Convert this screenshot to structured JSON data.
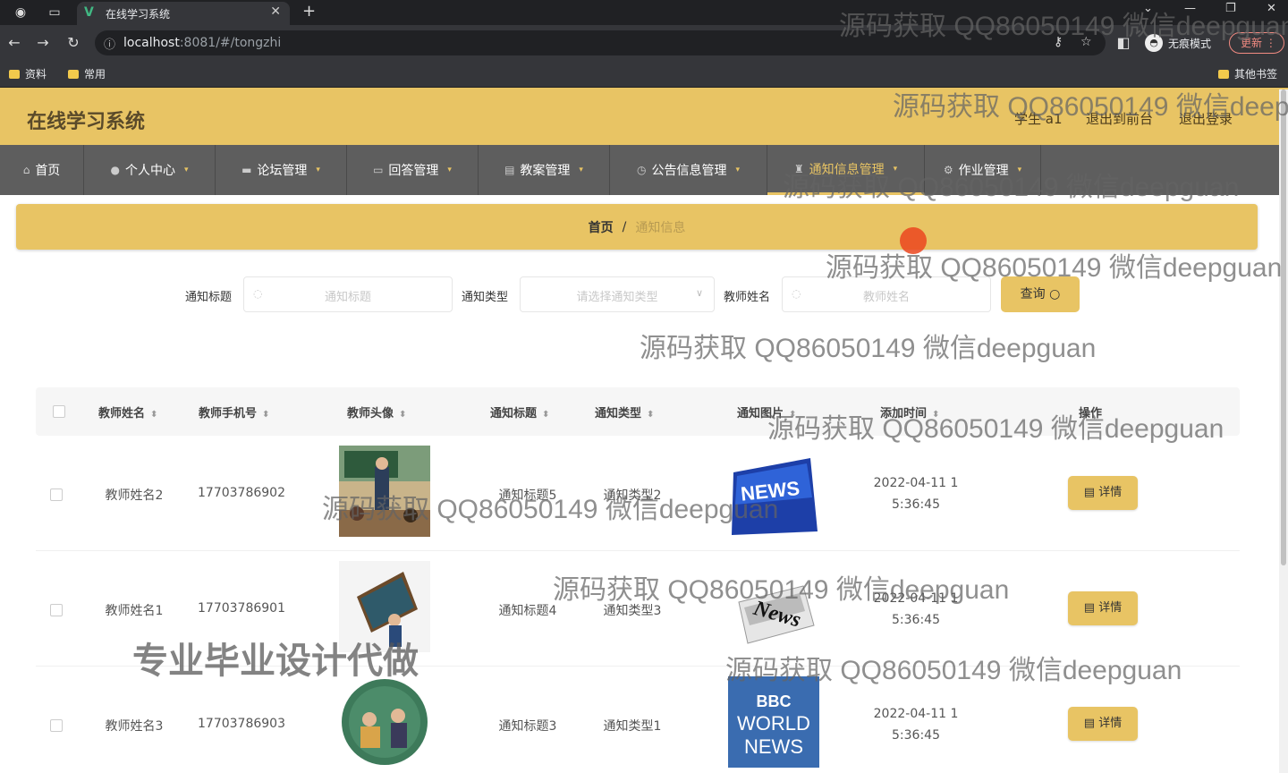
{
  "browser": {
    "tab_title": "在线学习系统",
    "url_host": "localhost",
    "url_rest": ":8081/#/tongzhi",
    "incognito_label": "无痕模式",
    "update_label": "更新",
    "bookmarks": [
      "资料",
      "常用"
    ],
    "other_bookmarks": "其他书签"
  },
  "app": {
    "title": "在线学习系统",
    "user": "学生 a1",
    "back_front": "退出到前台",
    "logout": "退出登录"
  },
  "nav": [
    {
      "label": "首页",
      "icon": "home-icon"
    },
    {
      "label": "个人中心",
      "icon": "user-icon"
    },
    {
      "label": "论坛管理",
      "icon": "forum-icon"
    },
    {
      "label": "回答管理",
      "icon": "answer-icon"
    },
    {
      "label": "教案管理",
      "icon": "lesson-icon"
    },
    {
      "label": "公告信息管理",
      "icon": "notice-icon"
    },
    {
      "label": "通知信息管理",
      "icon": "notify-icon"
    },
    {
      "label": "作业管理",
      "icon": "homework-icon"
    }
  ],
  "breadcrumb": {
    "home": "首页",
    "sep": "/",
    "current": "通知信息"
  },
  "filters": {
    "title_label": "通知标题",
    "title_placeholder": "通知标题",
    "type_label": "通知类型",
    "type_placeholder": "请选择通知类型",
    "teacher_label": "教师姓名",
    "teacher_placeholder": "教师姓名",
    "query_label": "查询"
  },
  "table": {
    "columns": [
      "教师姓名",
      "教师手机号",
      "教师头像",
      "通知标题",
      "通知类型",
      "通知图片",
      "添加时间",
      "操作"
    ],
    "detail_label": "详情",
    "rows": [
      {
        "name": "教师姓名2",
        "phone": "17703786902",
        "title": "通知标题5",
        "type": "通知类型2",
        "time1": "2022-04-11 1",
        "time2": "5:36:45",
        "avatar": "classroom",
        "image": "news-key"
      },
      {
        "name": "教师姓名1",
        "phone": "17703786901",
        "title": "通知标题4",
        "type": "通知类型3",
        "time1": "2022-04-11 1",
        "time2": "5:36:45",
        "avatar": "blackboard",
        "image": "news-paper"
      },
      {
        "name": "教师姓名3",
        "phone": "17703786903",
        "title": "通知标题3",
        "type": "通知类型1",
        "time1": "2022-04-11 1",
        "time2": "5:36:45",
        "avatar": "round-class",
        "image": "bbc"
      }
    ]
  },
  "news_text": {
    "key": "NEWS",
    "paper": "News",
    "bbc": "BBC",
    "world": "WORLD",
    "news": "NEWS"
  },
  "watermark": {
    "text": "源码获取 QQ86050149 微信deepguan",
    "big": "专业毕业设计代做"
  },
  "colors": {
    "accent": "#e8c464",
    "nav_bg": "#5e5e5e"
  }
}
